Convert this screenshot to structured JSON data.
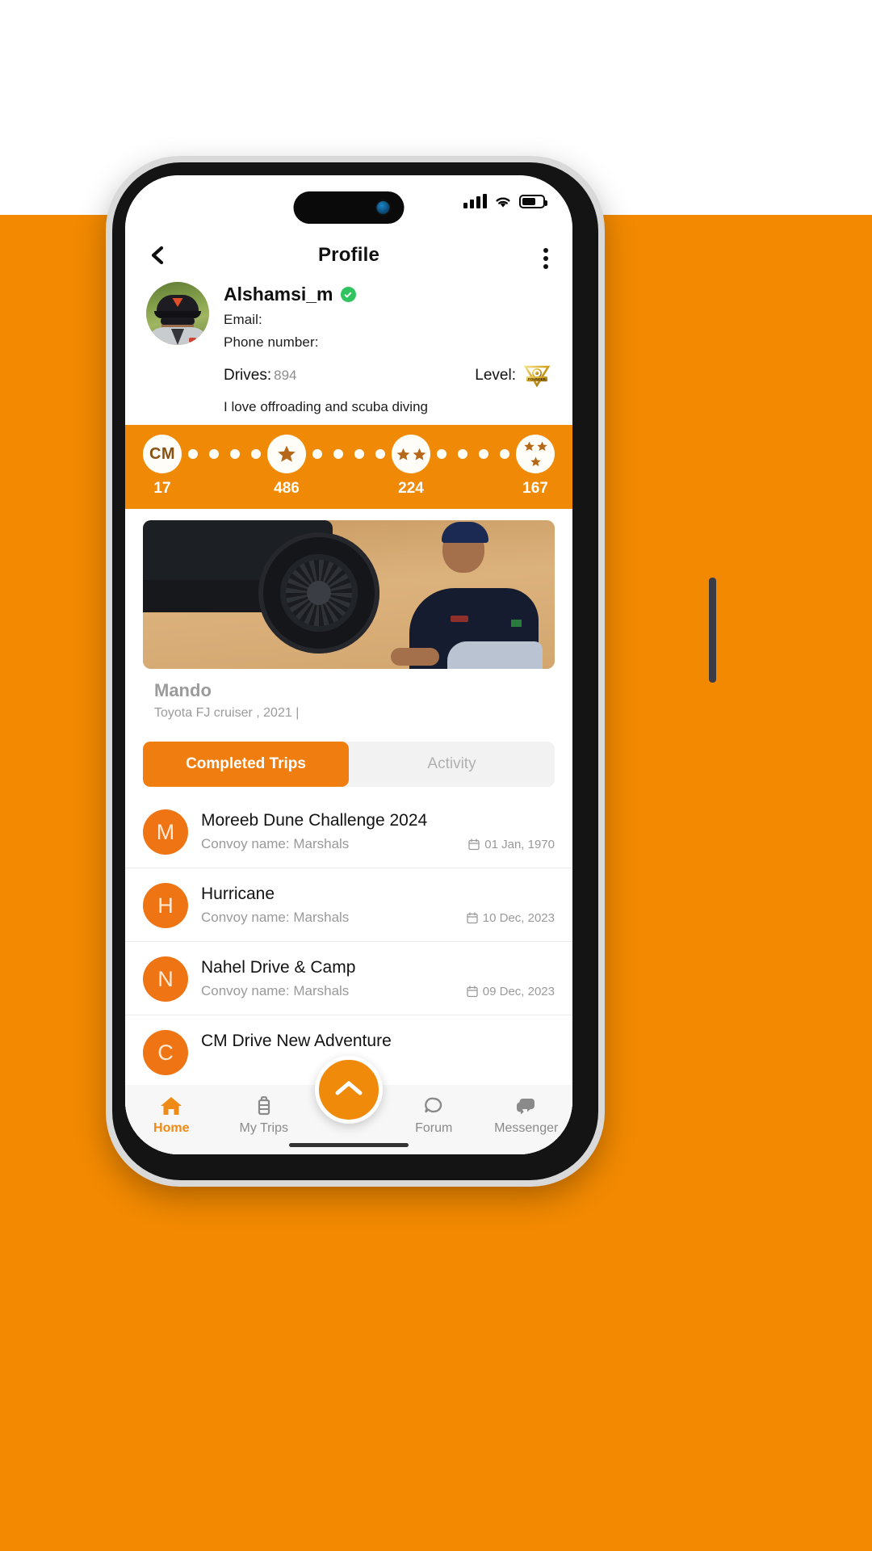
{
  "colors": {
    "brand_orange": "#f28900",
    "strip_orange": "#f08a06",
    "tab_active": "#ef7d10",
    "avatar_orange": "#ef7413",
    "verified_green": "#2fc45f",
    "muted_grey": "#9a9a9a"
  },
  "status_bar": {
    "signal_icon": "cellular-signal-icon",
    "wifi_icon": "wifi-icon",
    "battery_icon": "battery-icon",
    "battery_level": "66"
  },
  "header": {
    "back_icon": "back-chevron-icon",
    "title": "Profile",
    "menu_icon": "kebab-menu-icon"
  },
  "profile": {
    "avatar_icon": "user-avatar",
    "username": "Alshamsi_m",
    "verified_icon": "verified-check-icon",
    "email_label": "Email:",
    "email_value": "",
    "phone_label": "Phone number:",
    "phone_value": "",
    "drives_label": "Drives:",
    "drives_value": "894",
    "level_label": "Level:",
    "level_badge_icon": "founder-level-badge",
    "level_badge_text": "FOUNDER",
    "bio": "I love offroading and scuba diving"
  },
  "rank_strip": {
    "nodes": [
      {
        "icon": "cm-badge",
        "text": "CM",
        "stars": 0,
        "count": "17"
      },
      {
        "icon": "one-star-badge",
        "text": "",
        "stars": 1,
        "count": "486"
      },
      {
        "icon": "two-star-badge",
        "text": "",
        "stars": 2,
        "count": "224"
      },
      {
        "icon": "three-star-badge",
        "text": "",
        "stars": 3,
        "count": "167"
      }
    ],
    "dots_between": [
      4,
      4,
      4
    ]
  },
  "vehicle": {
    "photo_icon": "vehicle-photo",
    "name": "Mando",
    "details": "Toyota FJ cruiser , 2021 |"
  },
  "tabs": [
    {
      "label": "Completed Trips",
      "active": true
    },
    {
      "label": "Activity",
      "active": false
    }
  ],
  "trips": [
    {
      "initial": "M",
      "title": "Moreeb Dune Challenge 2024",
      "convoy": "Convoy name: Marshals",
      "date": "01 Jan, 1970",
      "date_icon": "calendar-icon"
    },
    {
      "initial": "H",
      "title": "Hurricane",
      "convoy": "Convoy name: Marshals",
      "date": "10 Dec, 2023",
      "date_icon": "calendar-icon"
    },
    {
      "initial": "N",
      "title": "Nahel Drive & Camp",
      "convoy": "Convoy name: Marshals",
      "date": "09 Dec, 2023",
      "date_icon": "calendar-icon"
    },
    {
      "initial": "C",
      "title": "CM Drive New Adventure",
      "convoy": "",
      "date": "",
      "date_icon": "calendar-icon"
    }
  ],
  "bottom_nav": {
    "items": [
      {
        "label": "Home",
        "icon": "home-icon",
        "active": true
      },
      {
        "label": "My Trips",
        "icon": "suitcase-icon",
        "active": false
      },
      {
        "label": "Forum",
        "icon": "chat-bubble-icon",
        "active": false
      },
      {
        "label": "Messenger",
        "icon": "messages-icon",
        "active": false
      }
    ],
    "fab_icon": "chevron-up-icon"
  }
}
